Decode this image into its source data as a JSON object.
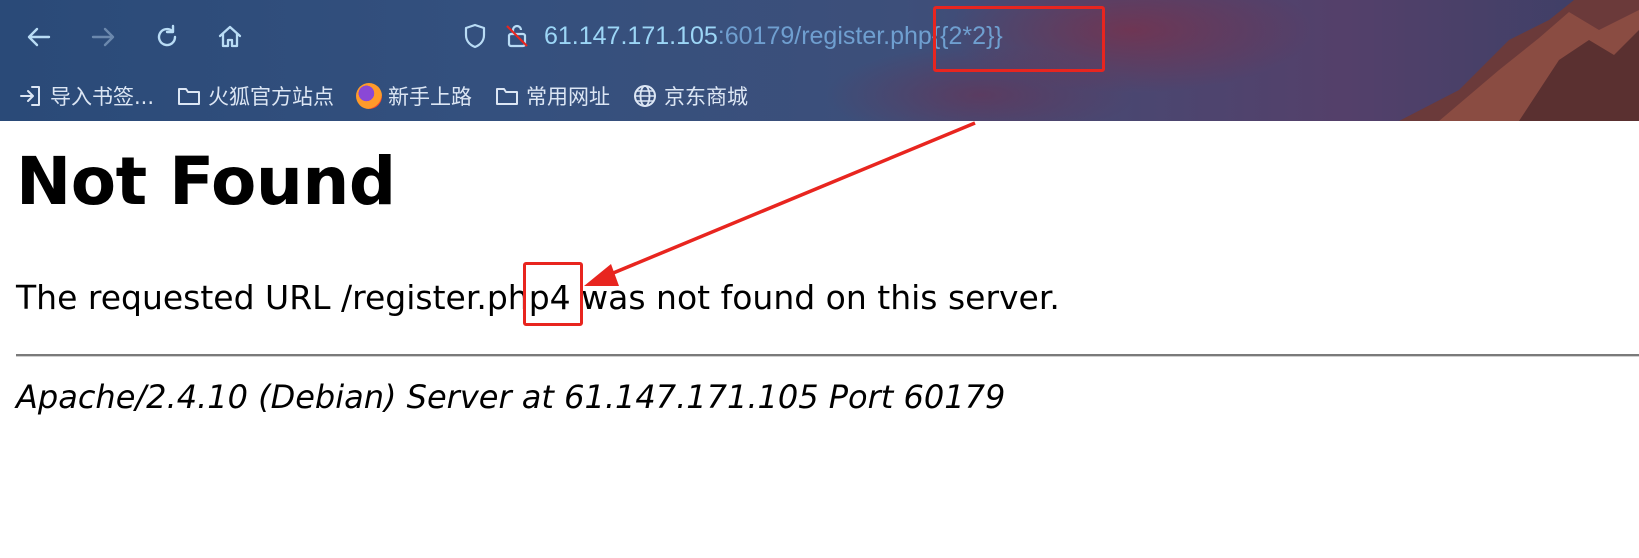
{
  "browser": {
    "url_host": "61.147.171.105",
    "url_rest": ":60179/register.php{{2*2}}",
    "icons": [
      "back-arrow-icon",
      "forward-arrow-icon",
      "reload-icon",
      "home-icon",
      "shield-icon",
      "insecure-lock-icon"
    ],
    "bookmarks": [
      {
        "label": "导入书签...",
        "icon": "import-icon"
      },
      {
        "label": "火狐官方站点",
        "icon": "folder-icon"
      },
      {
        "label": "新手上路",
        "icon": "firefox-icon"
      },
      {
        "label": "常用网址",
        "icon": "folder-icon"
      },
      {
        "label": "京东商城",
        "icon": "globe-icon"
      }
    ]
  },
  "page": {
    "title": "Not Found",
    "message_before": "The requested URL /register.ph",
    "message_p": "p",
    "message_highlight": "4",
    "message_after": " was not found on this server.",
    "server_signature": "Apache/2.4.10 (Debian) Server at 61.147.171.105 Port 60179"
  },
  "annotation": {
    "color": "#e8251f",
    "icons": [
      "highlight-box",
      "arrow-icon"
    ]
  }
}
